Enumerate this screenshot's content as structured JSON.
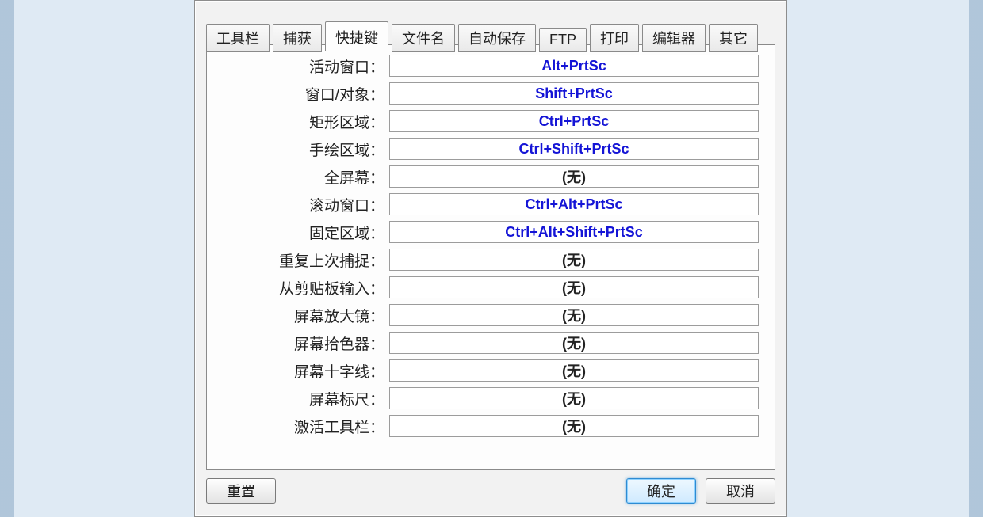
{
  "tabs": [
    {
      "id": "toolbar",
      "label": "工具栏"
    },
    {
      "id": "capture",
      "label": "捕获"
    },
    {
      "id": "hotkeys",
      "label": "快捷键",
      "active": true
    },
    {
      "id": "filename",
      "label": "文件名"
    },
    {
      "id": "autosave",
      "label": "自动保存"
    },
    {
      "id": "ftp",
      "label": "FTP"
    },
    {
      "id": "print",
      "label": "打印"
    },
    {
      "id": "editor",
      "label": "编辑器"
    },
    {
      "id": "other",
      "label": "其它"
    }
  ],
  "hotkeys": {
    "none_label": "(无)",
    "rows": [
      {
        "id": "active-window",
        "label": "活动窗口：",
        "value": "Alt+PrtSc",
        "kind": "hotkey"
      },
      {
        "id": "window-object",
        "label": "窗口/对象：",
        "value": "Shift+PrtSc",
        "kind": "hotkey"
      },
      {
        "id": "rect-region",
        "label": "矩形区域：",
        "value": "Ctrl+PrtSc",
        "kind": "hotkey"
      },
      {
        "id": "freehand-region",
        "label": "手绘区域：",
        "value": "Ctrl+Shift+PrtSc",
        "kind": "hotkey"
      },
      {
        "id": "full-screen",
        "label": "全屏幕：",
        "value": "(无)",
        "kind": "none"
      },
      {
        "id": "scrolling-window",
        "label": "滚动窗口：",
        "value": "Ctrl+Alt+PrtSc",
        "kind": "hotkey"
      },
      {
        "id": "fixed-region",
        "label": "固定区域：",
        "value": "Ctrl+Alt+Shift+PrtSc",
        "kind": "hotkey"
      },
      {
        "id": "repeat-last",
        "label": "重复上次捕捉：",
        "value": "(无)",
        "kind": "none"
      },
      {
        "id": "from-clipboard",
        "label": "从剪贴板输入：",
        "value": "(无)",
        "kind": "none"
      },
      {
        "id": "magnifier",
        "label": "屏幕放大镜：",
        "value": "(无)",
        "kind": "none"
      },
      {
        "id": "color-picker",
        "label": "屏幕拾色器：",
        "value": "(无)",
        "kind": "none"
      },
      {
        "id": "crosshair",
        "label": "屏幕十字线：",
        "value": "(无)",
        "kind": "none"
      },
      {
        "id": "ruler",
        "label": "屏幕标尺：",
        "value": "(无)",
        "kind": "none"
      },
      {
        "id": "activate-toolbar",
        "label": "激活工具栏：",
        "value": "(无)",
        "kind": "none"
      }
    ]
  },
  "buttons": {
    "reset": "重置",
    "ok": "确定",
    "cancel": "取消"
  }
}
